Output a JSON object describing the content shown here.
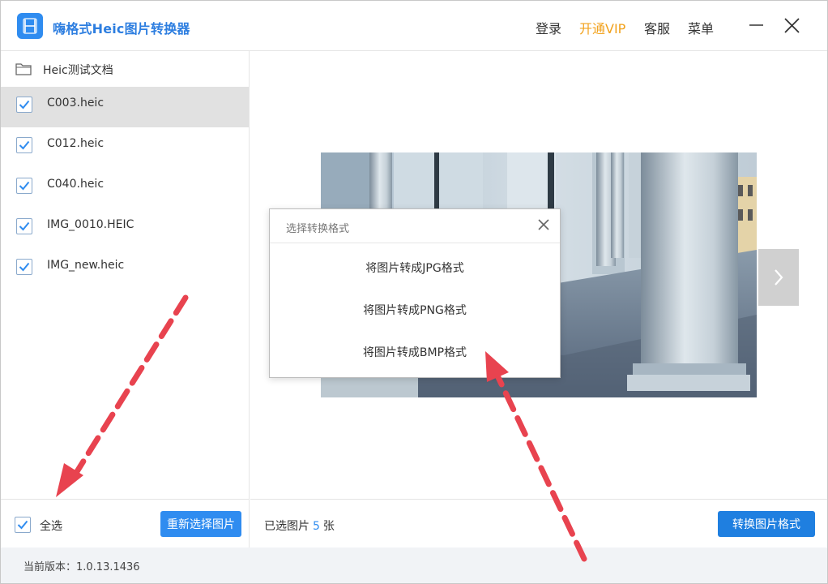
{
  "titlebar": {
    "app_title": "嗨格式Heic图片转换器",
    "login": "登录",
    "vip": "开通VIP",
    "service": "客服",
    "menu": "菜单",
    "accent_color": "#2f8cf0",
    "vip_color": "#f2a21d"
  },
  "sidebar": {
    "folder_label": "Heic测试文档",
    "files": [
      {
        "name": "C003.heic",
        "checked": true,
        "selected": true
      },
      {
        "name": "C012.heic",
        "checked": true,
        "selected": false
      },
      {
        "name": "C040.heic",
        "checked": true,
        "selected": false
      },
      {
        "name": "IMG_0010.HEIC",
        "checked": true,
        "selected": false
      },
      {
        "name": "IMG_new.heic",
        "checked": true,
        "selected": false
      }
    ],
    "select_all_label": "全选",
    "reselect_label": "重新选择图片"
  },
  "main": {
    "count_prefix": "已选图片",
    "count_value": "5",
    "count_suffix": "张",
    "convert_label": "转换图片格式"
  },
  "dialog": {
    "title": "选择转换格式",
    "options": [
      "将图片转成JPG格式",
      "将图片转成PNG格式",
      "将图片转成BMP格式"
    ]
  },
  "status": {
    "version": "当前版本：1.0.13.1436"
  }
}
